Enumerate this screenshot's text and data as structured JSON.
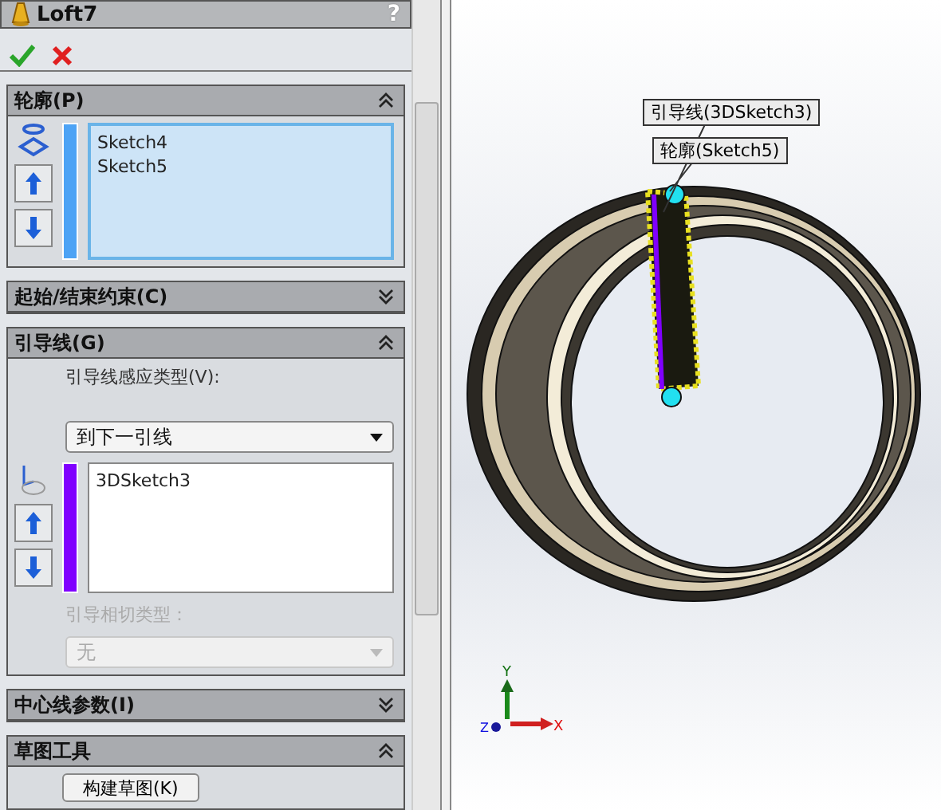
{
  "window": {
    "title": "Loft7",
    "help": "?"
  },
  "sections": [
    {
      "kind": "profiles",
      "title": "轮廓(P)",
      "expanded": true,
      "focused": true,
      "color": "#4da3f5",
      "items": [
        "Sketch4",
        "Sketch5"
      ]
    },
    {
      "title": "起始/结束约束(C)",
      "expanded": false
    },
    {
      "kind": "guides",
      "title": "引导线(G)",
      "expanded": true,
      "focused": false,
      "color": "#8000ff",
      "influence_label": "引导线感应类型(V):",
      "influence_value": "到下一引线",
      "items": [
        "3DSketch3"
      ],
      "tangency_label": "引导相切类型：",
      "tangency_value": "无",
      "tangency_disabled": true
    },
    {
      "title": "中心线参数(I)",
      "expanded": false
    },
    {
      "kind": "tools",
      "title": "草图工具",
      "expanded": true,
      "button": "构建草图(K)"
    }
  ],
  "viewport": {
    "callouts": [
      "引导线(3DSketch3)",
      "轮廓(Sketch5)"
    ],
    "triad": {
      "x": "X",
      "y": "Y",
      "z": "Z"
    }
  }
}
